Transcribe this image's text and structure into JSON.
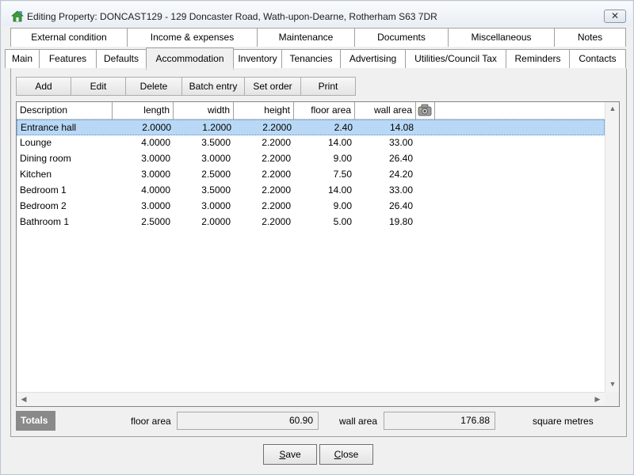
{
  "window": {
    "title": "Editing Property: DONCAST129 - 129 Doncaster Road, Wath-upon-Dearne, Rotherham S63 7DR",
    "close_label": "✕"
  },
  "tabs_row1": [
    {
      "label": "External condition"
    },
    {
      "label": "Income & expenses"
    },
    {
      "label": "Maintenance"
    },
    {
      "label": "Documents"
    },
    {
      "label": "Miscellaneous"
    },
    {
      "label": "Notes"
    }
  ],
  "tabs_row2": [
    {
      "label": "Main"
    },
    {
      "label": "Features"
    },
    {
      "label": "Defaults"
    },
    {
      "label": "Accommodation",
      "active": true
    },
    {
      "label": "Inventory"
    },
    {
      "label": "Tenancies"
    },
    {
      "label": "Advertising"
    },
    {
      "label": "Utilities/Council Tax"
    },
    {
      "label": "Reminders"
    },
    {
      "label": "Contacts"
    }
  ],
  "toolbar": {
    "add": "Add",
    "edit": "Edit",
    "delete": "Delete",
    "batch_entry": "Batch entry",
    "set_order": "Set order",
    "print": "Print"
  },
  "grid": {
    "columns": [
      "Description",
      "length",
      "width",
      "height",
      "floor area",
      "wall area"
    ],
    "column_icon": "camera-icon",
    "rows": [
      {
        "description": "Entrance hall",
        "length": "2.0000",
        "width": "1.2000",
        "height": "2.2000",
        "floor_area": "2.40",
        "wall_area": "14.08",
        "selected": true
      },
      {
        "description": "Lounge",
        "length": "4.0000",
        "width": "3.5000",
        "height": "2.2000",
        "floor_area": "14.00",
        "wall_area": "33.00"
      },
      {
        "description": "Dining room",
        "length": "3.0000",
        "width": "3.0000",
        "height": "2.2000",
        "floor_area": "9.00",
        "wall_area": "26.40"
      },
      {
        "description": "Kitchen",
        "length": "3.0000",
        "width": "2.5000",
        "height": "2.2000",
        "floor_area": "7.50",
        "wall_area": "24.20"
      },
      {
        "description": "Bedroom 1",
        "length": "4.0000",
        "width": "3.5000",
        "height": "2.2000",
        "floor_area": "14.00",
        "wall_area": "33.00"
      },
      {
        "description": "Bedroom 2",
        "length": "3.0000",
        "width": "3.0000",
        "height": "2.2000",
        "floor_area": "9.00",
        "wall_area": "26.40"
      },
      {
        "description": "Bathroom 1",
        "length": "2.5000",
        "width": "2.0000",
        "height": "2.2000",
        "floor_area": "5.00",
        "wall_area": "19.80"
      }
    ]
  },
  "totals": {
    "label": "Totals",
    "floor_area_label": "floor area",
    "floor_area_value": "60.90",
    "wall_area_label": "wall area",
    "wall_area_value": "176.88",
    "units": "square metres"
  },
  "footer": {
    "save_accel": "S",
    "save_rest": "ave",
    "close_accel": "C",
    "close_rest": "lose"
  },
  "colors": {
    "selection": "#b8d8f5",
    "totals_badge": "#8a8a8a"
  }
}
